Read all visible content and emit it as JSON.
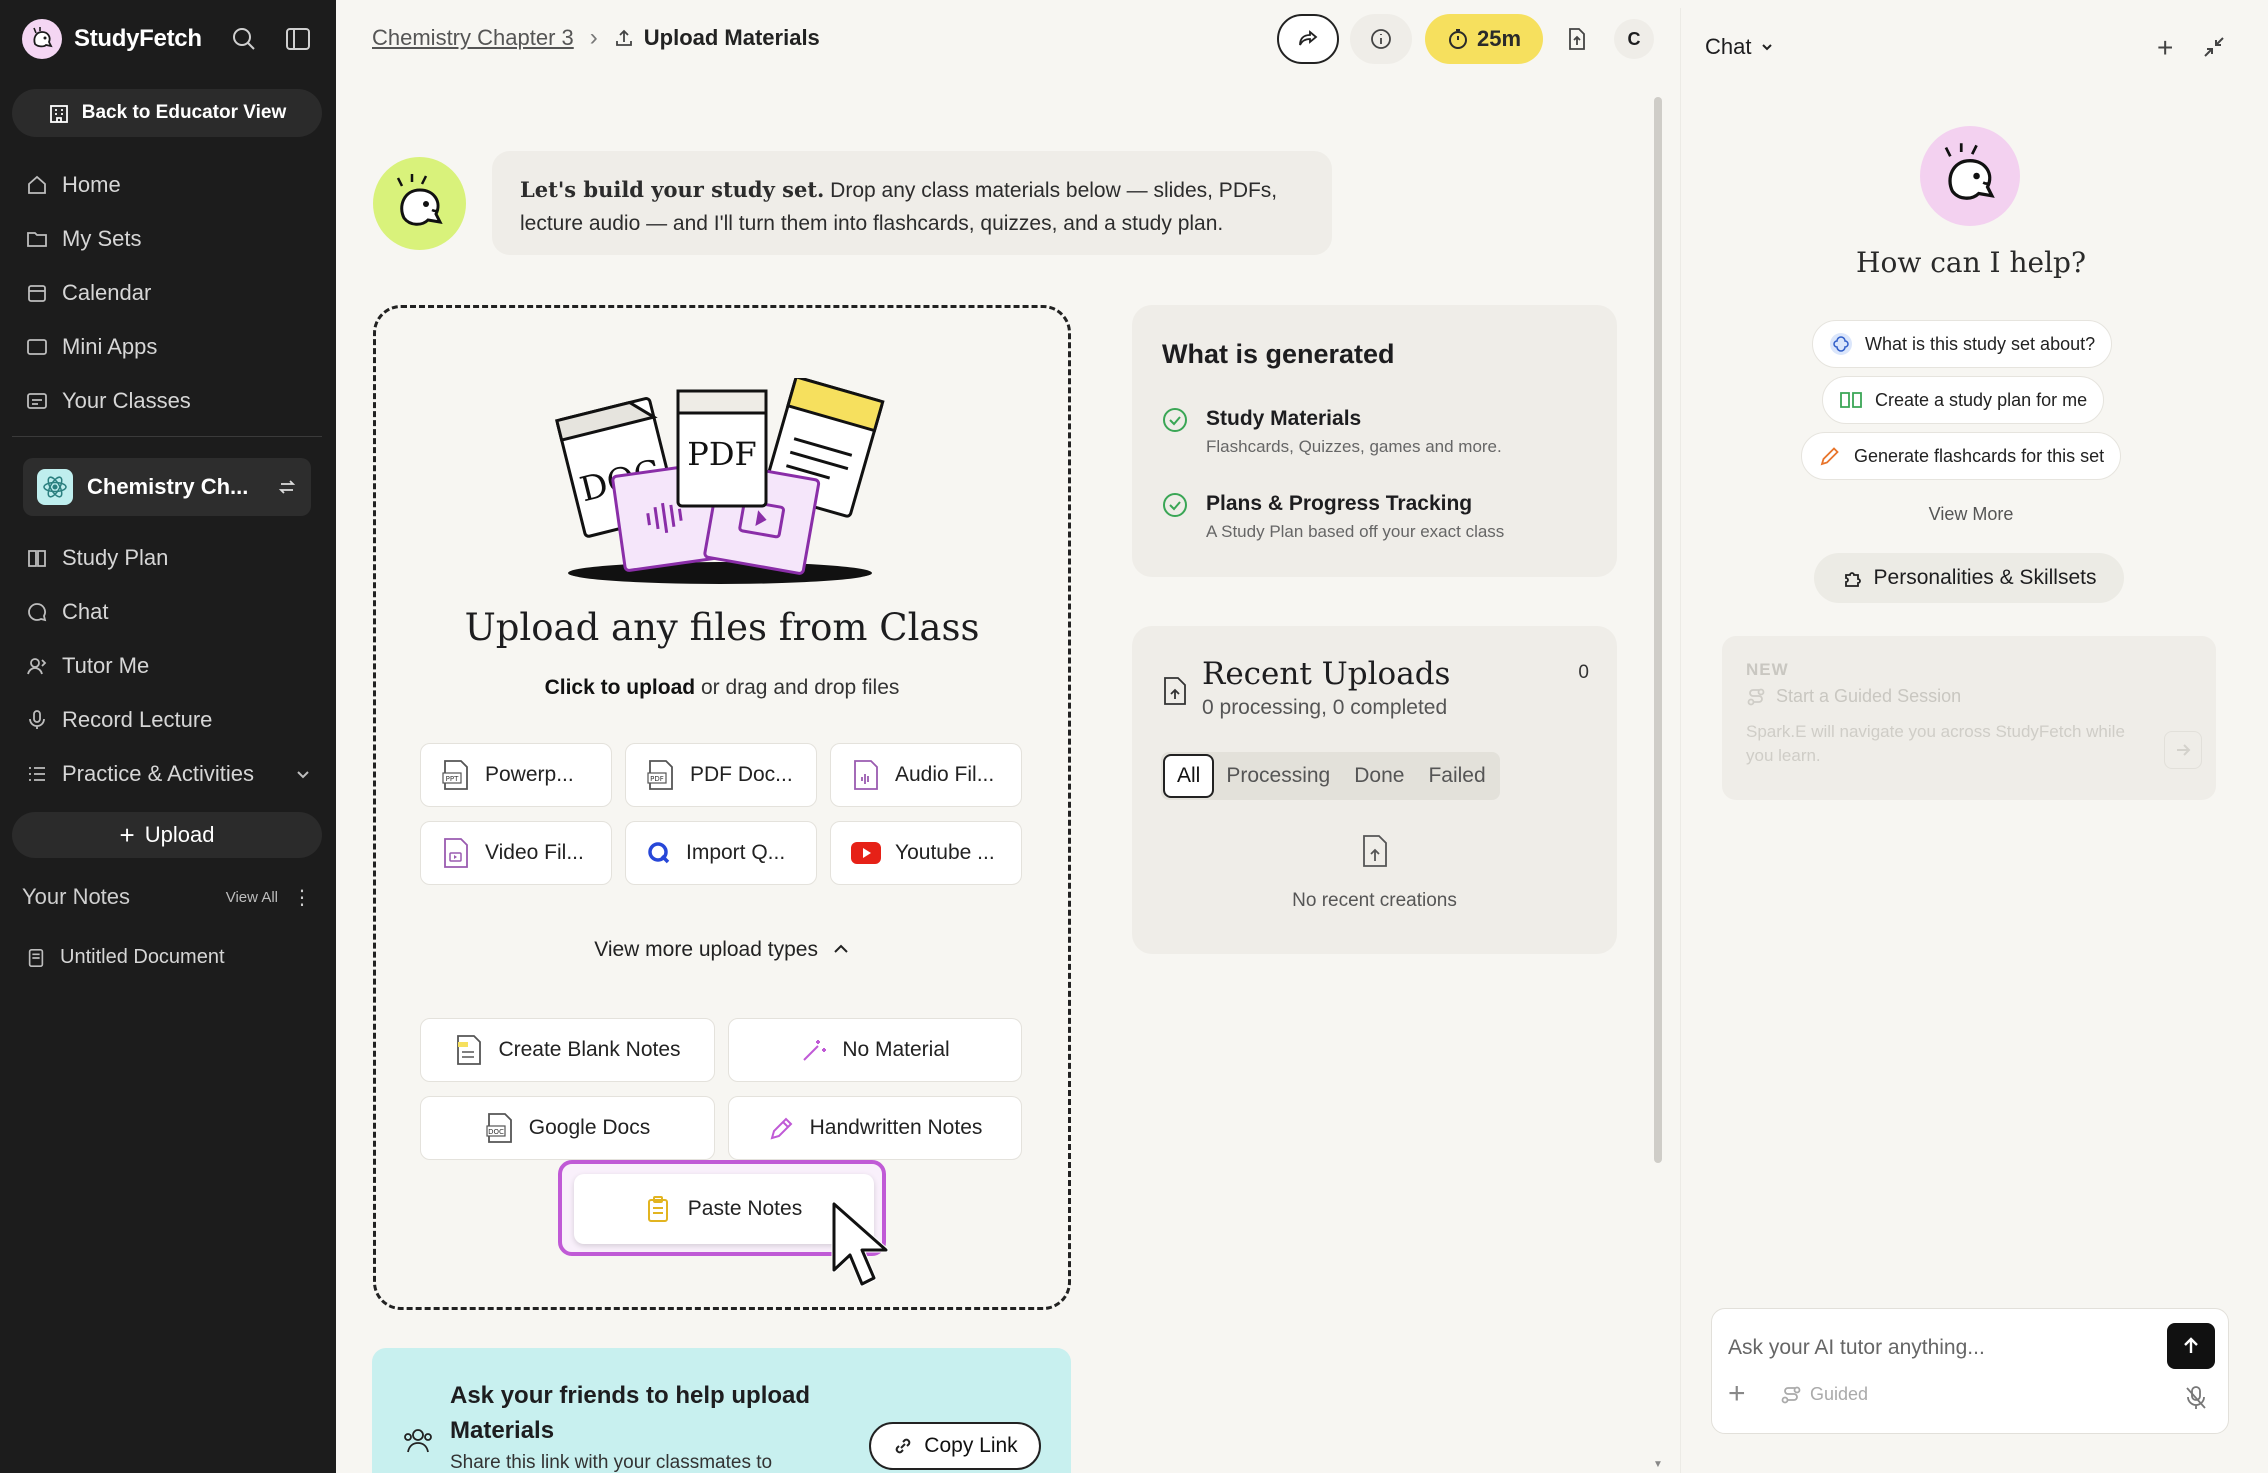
{
  "app": {
    "name": "StudyFetch"
  },
  "sidebar": {
    "educator_button": "Back to Educator View",
    "nav_top": [
      {
        "label": "Home",
        "icon": "home-icon"
      },
      {
        "label": "My Sets",
        "icon": "folder-icon"
      },
      {
        "label": "Calendar",
        "icon": "calendar-icon"
      },
      {
        "label": "Mini Apps",
        "icon": "window-icon"
      },
      {
        "label": "Your Classes",
        "icon": "classes-icon"
      }
    ],
    "current_class": "Chemistry Ch...",
    "nav_class": [
      {
        "label": "Study Plan",
        "icon": "book-icon"
      },
      {
        "label": "Chat",
        "icon": "chat-icon"
      },
      {
        "label": "Tutor Me",
        "icon": "tutor-icon"
      },
      {
        "label": "Record Lecture",
        "icon": "mic-icon"
      },
      {
        "label": "Practice & Activities",
        "icon": "list-icon"
      }
    ],
    "upload_button": "Upload",
    "notes_title": "Your Notes",
    "notes_view_all": "View All",
    "notes": [
      {
        "label": "Untitled Document"
      }
    ]
  },
  "topbar": {
    "breadcrumb_parent": "Chemistry Chapter 3",
    "breadcrumb_current": "Upload Materials",
    "timer": "25m",
    "avatar_initial": "C"
  },
  "intro": {
    "bold": "Let's build your study set.",
    "text": " Drop any class materials below — slides, PDFs, lecture audio — and I'll turn them into flashcards, quizzes, and a study plan."
  },
  "upload": {
    "illustration": {
      "doc": "DOC",
      "pdf": "PDF"
    },
    "title": "Upload any files from Class",
    "sub_bold": "Click to upload",
    "sub_rest": " or drag and drop files",
    "types": [
      "Powerp...",
      "PDF Doc...",
      "Audio Fil...",
      "Video Fil...",
      "Import Q...",
      "Youtube ..."
    ],
    "view_more": "View more upload types",
    "more": [
      "Create Blank Notes",
      "No Material",
      "Google Docs",
      "Handwritten Notes"
    ],
    "paste": "Paste Notes"
  },
  "friends": {
    "title": "Ask your friends to help upload Materials",
    "sub": "Share this link with your classmates to",
    "copy_link": "Copy Link"
  },
  "generated": {
    "title": "What is generated",
    "items": [
      {
        "title": "Study Materials",
        "desc": "Flashcards, Quizzes, games and more."
      },
      {
        "title": "Plans & Progress Tracking",
        "desc": "A Study Plan based off your exact class"
      }
    ]
  },
  "recent": {
    "title": "Recent Uploads",
    "sub": "0 processing, 0 completed",
    "count": "0",
    "tabs": [
      "All",
      "Processing",
      "Done",
      "Failed"
    ],
    "empty": "No recent creations"
  },
  "chat": {
    "header": "Chat",
    "question": "How can I help?",
    "suggestions": [
      "What is this study set about?",
      "Create a study plan for me",
      "Generate flashcards for this set"
    ],
    "view_more": "View More",
    "personalities": "Personalities & Skillsets",
    "guided_new": "NEW",
    "guided_title": "Start a Guided Session",
    "guided_desc": "Spark.E will navigate you across StudyFetch while you learn.",
    "input_placeholder": "Ask your AI tutor anything...",
    "guided_chip": "Guided"
  },
  "colors": {
    "accent_purple": "#c05ad6",
    "timer_yellow": "#f6e05e",
    "mascot_green": "#d9f27b",
    "friends_teal": "#c8f0ef",
    "check_green": "#3aa655"
  }
}
